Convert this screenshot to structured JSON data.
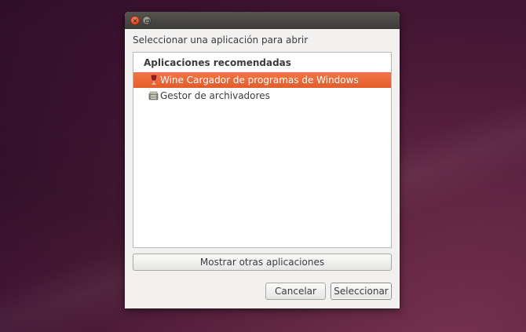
{
  "dialog": {
    "title": "Seleccionar una aplicación para abrir",
    "list": {
      "header": "Aplicaciones recomendadas",
      "items": [
        {
          "label": "Wine Cargador de programas de Windows",
          "icon": "wine-glass-icon",
          "selected": true
        },
        {
          "label": "Gestor de archivadores",
          "icon": "archive-manager-icon",
          "selected": false
        }
      ]
    },
    "buttons": {
      "show_others": "Mostrar otras aplicaciones",
      "cancel": "Cancelar",
      "select": "Seleccionar"
    }
  },
  "colors": {
    "selection": "#e8622f",
    "titlebar": "#3d3c38",
    "close_button": "#e5552a",
    "dialog_bg": "#f2f1f0"
  }
}
